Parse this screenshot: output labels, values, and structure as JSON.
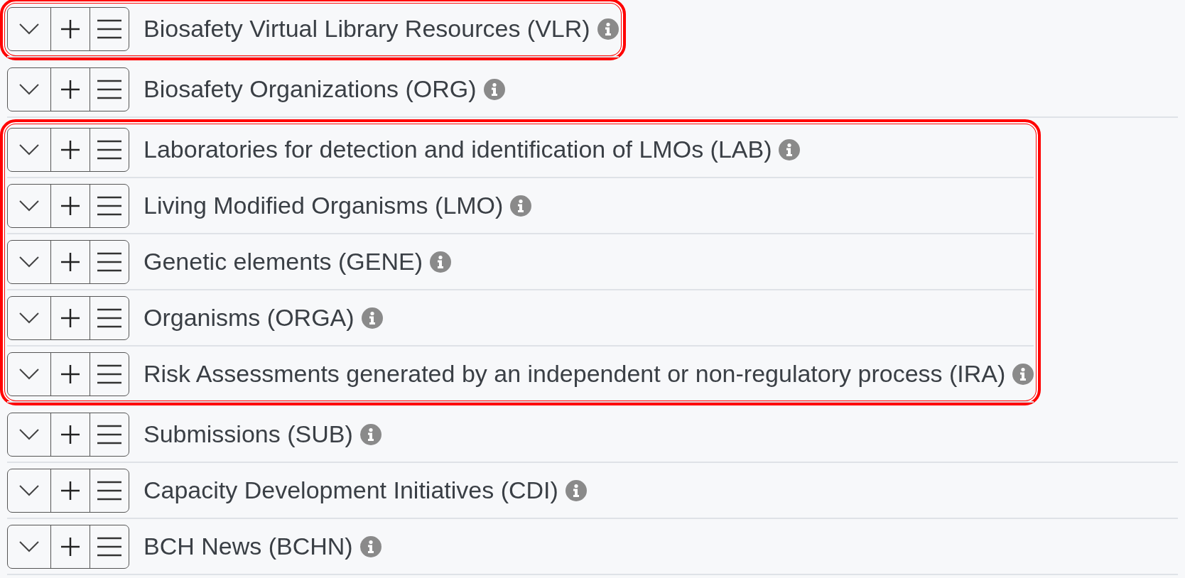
{
  "groups": [
    {
      "highlighted": true,
      "rows": [
        {
          "label": "Biosafety Virtual Library Resources (VLR)"
        }
      ]
    },
    {
      "highlighted": false,
      "rows": [
        {
          "label": "Biosafety Organizations (ORG)"
        }
      ]
    },
    {
      "highlighted": true,
      "rows": [
        {
          "label": "Laboratories for detection and identification of LMOs (LAB)"
        },
        {
          "label": "Living Modified Organisms (LMO)"
        },
        {
          "label": "Genetic elements (GENE)"
        },
        {
          "label": "Organisms (ORGA)"
        },
        {
          "label": "Risk Assessments generated by an independent or non-regulatory process (IRA)"
        }
      ]
    },
    {
      "highlighted": false,
      "rows": [
        {
          "label": "Submissions (SUB)"
        },
        {
          "label": "Capacity Development Initiatives (CDI)"
        },
        {
          "label": "BCH News (BCHN)"
        }
      ]
    }
  ]
}
